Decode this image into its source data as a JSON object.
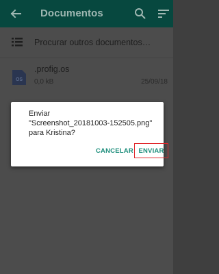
{
  "appbar": {
    "title": "Documentos",
    "icons": {
      "back": "arrow-back-icon",
      "search": "search-icon",
      "sort": "sort-icon"
    }
  },
  "list": {
    "browse_label": "Procurar outros documentos…",
    "files": [
      {
        "name": ".profig.os",
        "size": "0,0 kB",
        "date": "25/09/18",
        "icon_label": "OS"
      }
    ]
  },
  "dialog": {
    "line1": "Enviar",
    "line2": "\"Screenshot_20181003-152505.png\"",
    "line3": "para Kristina?",
    "cancel_label": "CANCELAR",
    "send_label": "ENVIAR"
  },
  "colors": {
    "appbar": "#07483f",
    "accent": "#1c8d7b",
    "highlight": "#e0282c"
  }
}
